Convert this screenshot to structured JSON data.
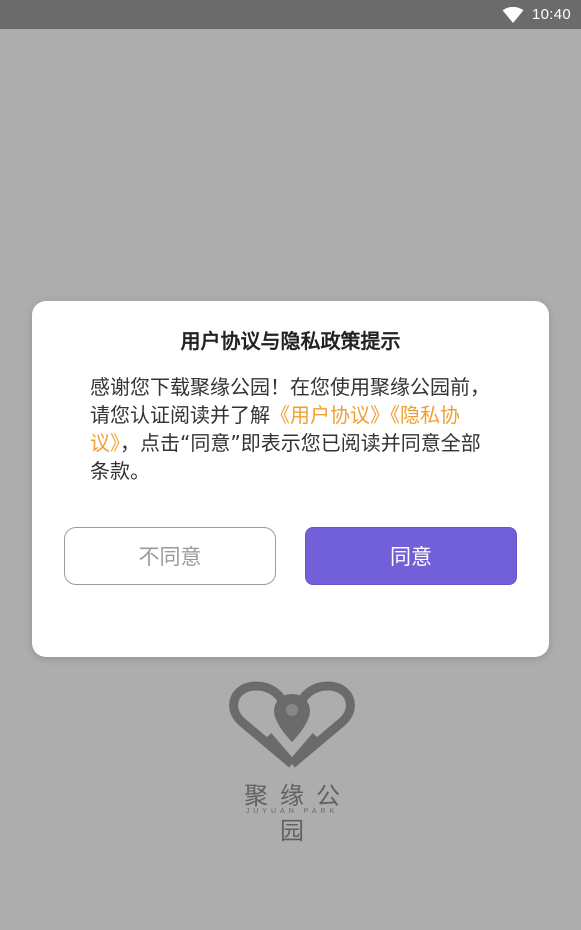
{
  "status_bar": {
    "time": "10:40",
    "wifi_icon": "wifi-icon"
  },
  "splash": {
    "logo_icon": "heart-location-pin-logo",
    "logo_text": "聚缘公园",
    "logo_subtext": "JUYUAN PARK"
  },
  "dialog": {
    "title": "用户协议与隐私政策提示",
    "body": {
      "part1": "感谢您下载聚缘公园！在您使用聚缘公园前，请您认证阅读并了解",
      "user_agreement_link": "《用户协议》",
      "privacy_link": "《隐私协议》",
      "part2": "，点击“同意”即表示您已阅读并同意全部条款。"
    },
    "disagree_label": "不同意",
    "agree_label": "同意"
  },
  "colors": {
    "link": "#f0a030",
    "primary": "#7160d8",
    "status_bar": "#6b6b6b"
  }
}
